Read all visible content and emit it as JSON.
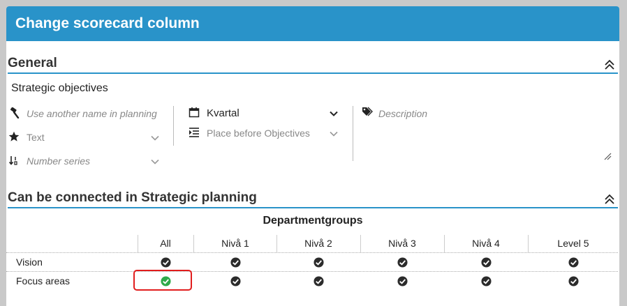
{
  "dialog": {
    "title": "Change scorecard column"
  },
  "general": {
    "heading": "General",
    "name_value": "Strategic objectives",
    "alt_name_placeholder": "Use another name in planning",
    "type_value": "Text",
    "number_series_placeholder": "Number series",
    "period_value": "Kvartal",
    "position_value": "Place before Objectives",
    "description_placeholder": "Description"
  },
  "connect": {
    "heading": "Can be connected in Strategic planning",
    "group_title": "Departmentgroups",
    "columns": [
      "All",
      "Nivå 1",
      "Nivå 2",
      "Nivå 3",
      "Nivå 4",
      "Level 5"
    ],
    "rows": [
      {
        "label": "Vision",
        "checked": [
          true,
          true,
          true,
          true,
          true,
          true
        ]
      },
      {
        "label": "Focus areas",
        "checked": [
          true,
          true,
          true,
          true,
          true,
          true
        ]
      }
    ],
    "highlight": {
      "row": 1,
      "col": 0,
      "check_color": "#2eaa4a",
      "outline_color": "#e11d1d"
    }
  },
  "colors": {
    "accent": "#2993c9",
    "check_default": "#2b2b2b"
  }
}
